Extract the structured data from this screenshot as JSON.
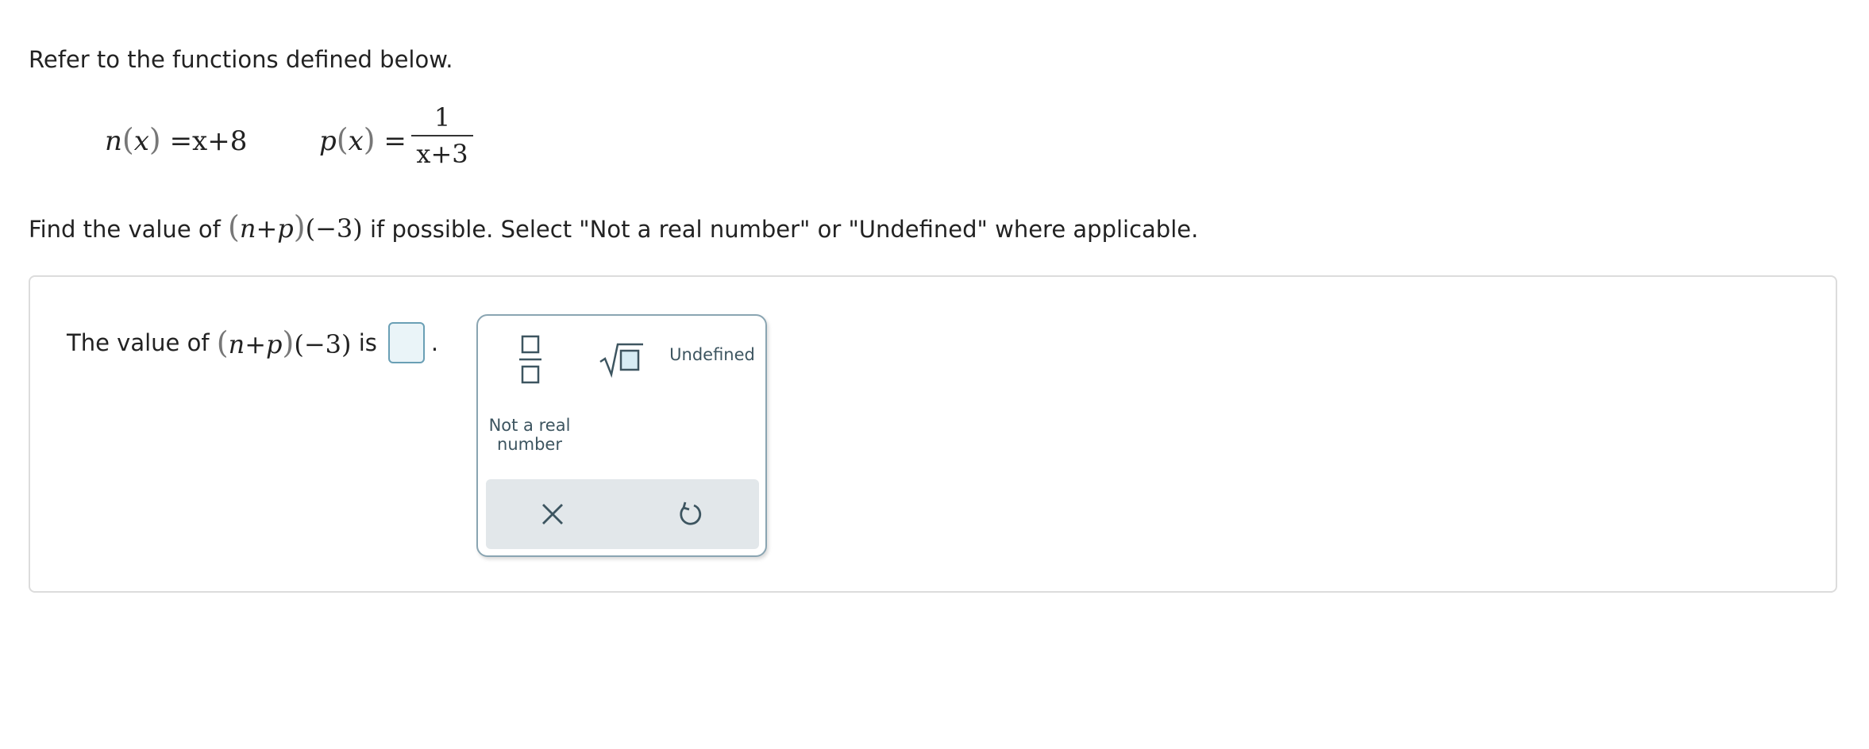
{
  "prompt": {
    "intro": "Refer to the functions defined below.",
    "find_prefix": "Find the value of",
    "find_suffix": "if possible. Select \"Not a real number\" or \"Undefined\" where applicable."
  },
  "functions": {
    "n": {
      "name": "n",
      "var": "x",
      "rhs": "=x+8"
    },
    "p": {
      "name": "p",
      "var": "x",
      "numerator": "1",
      "denominator": "x+3"
    }
  },
  "expression": {
    "lparen": "(",
    "inner": "n+p",
    "rparen": ")",
    "arg": "(−3)"
  },
  "answer": {
    "prefix": "The value of",
    "suffix": "is",
    "period": ".",
    "value": ""
  },
  "keypad": {
    "undefined_label": "Undefined",
    "not_real_label": "Not a real number"
  },
  "colors": {
    "accent": "#6a9fb5",
    "input_bg": "#eaf4f8",
    "tray_bg": "#e2e7ea",
    "icon": "#3d5560"
  },
  "icons": {
    "fraction": "fraction-icon",
    "sqrt": "square-root-icon",
    "clear": "close-icon",
    "reset": "reset-icon"
  }
}
